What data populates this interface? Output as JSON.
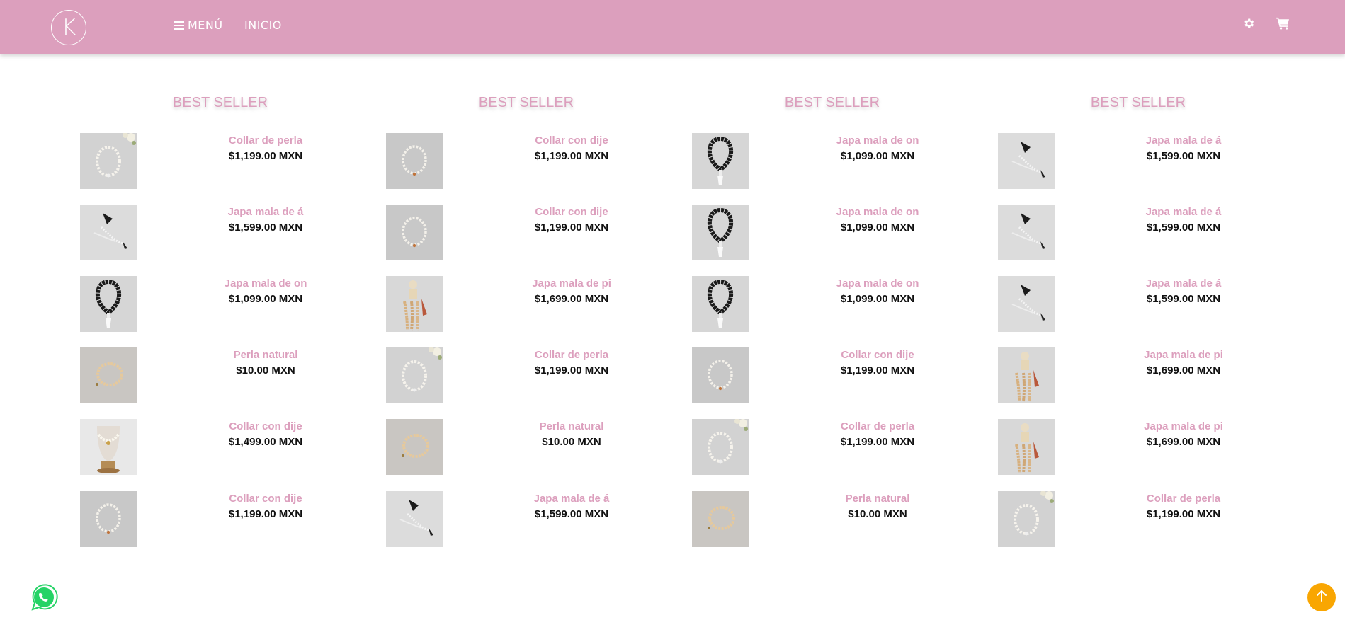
{
  "header": {
    "logo_letter": "K",
    "menu_label": "MENÚ",
    "home_label": "INICIO",
    "background": "#dc9fbd",
    "icons": [
      "gear-icon",
      "cart-icon"
    ]
  },
  "columns": [
    {
      "title": "BEST SELLER",
      "products": [
        {
          "name": "Collar de perla",
          "price": "$1,199.00 MXN",
          "thumb": "pearl-necklace-flowers"
        },
        {
          "name": "Japa mala de á",
          "price": "$1,599.00 MXN",
          "thumb": "black-tassel-mala"
        },
        {
          "name": "Japa mala de on",
          "price": "$1,099.00 MXN",
          "thumb": "onyx-mala"
        },
        {
          "name": "Perla natural",
          "price": "$10.00 MXN",
          "thumb": "pearl-bracelet"
        },
        {
          "name": "Collar con dije",
          "price": "$1,499.00 MXN",
          "thumb": "necklace-on-stand"
        },
        {
          "name": "Collar con dije",
          "price": "$1,199.00 MXN",
          "thumb": "pearl-necklace-pendant"
        }
      ]
    },
    {
      "title": "BEST SELLER",
      "products": [
        {
          "name": "Collar con dije",
          "price": "$1,199.00 MXN",
          "thumb": "pearl-necklace-pendant"
        },
        {
          "name": "Collar con dije",
          "price": "$1,199.00 MXN",
          "thumb": "pearl-necklace-pendant"
        },
        {
          "name": "Japa mala de pi",
          "price": "$1,699.00 MXN",
          "thumb": "buddha-mala"
        },
        {
          "name": "Collar de perla",
          "price": "$1,199.00 MXN",
          "thumb": "pearl-necklace-flowers"
        },
        {
          "name": "Perla natural",
          "price": "$10.00 MXN",
          "thumb": "pearl-bracelet"
        },
        {
          "name": "Japa mala de á",
          "price": "$1,599.00 MXN",
          "thumb": "black-tassel-mala"
        }
      ]
    },
    {
      "title": "BEST SELLER",
      "products": [
        {
          "name": "Japa mala de on",
          "price": "$1,099.00 MXN",
          "thumb": "onyx-mala"
        },
        {
          "name": "Japa mala de on",
          "price": "$1,099.00 MXN",
          "thumb": "onyx-mala"
        },
        {
          "name": "Japa mala de on",
          "price": "$1,099.00 MXN",
          "thumb": "onyx-mala"
        },
        {
          "name": "Collar con dije",
          "price": "$1,199.00 MXN",
          "thumb": "pearl-necklace-pendant"
        },
        {
          "name": "Collar de perla",
          "price": "$1,199.00 MXN",
          "thumb": "pearl-necklace-flowers"
        },
        {
          "name": "Perla natural",
          "price": "$10.00 MXN",
          "thumb": "pearl-bracelet"
        }
      ]
    },
    {
      "title": "BEST SELLER",
      "products": [
        {
          "name": "Japa mala de á",
          "price": "$1,599.00 MXN",
          "thumb": "black-tassel-mala"
        },
        {
          "name": "Japa mala de á",
          "price": "$1,599.00 MXN",
          "thumb": "black-tassel-mala"
        },
        {
          "name": "Japa mala de á",
          "price": "$1,599.00 MXN",
          "thumb": "black-tassel-mala"
        },
        {
          "name": "Japa mala de pi",
          "price": "$1,699.00 MXN",
          "thumb": "buddha-mala"
        },
        {
          "name": "Japa mala de pi",
          "price": "$1,699.00 MXN",
          "thumb": "buddha-mala"
        },
        {
          "name": "Collar de perla",
          "price": "$1,199.00 MXN",
          "thumb": "pearl-necklace-flowers"
        }
      ]
    }
  ],
  "floating": {
    "whatsapp_icon": "whatsapp-icon",
    "scroll_icon": "arrow-up-icon",
    "scroll_color": "#f9a602"
  }
}
